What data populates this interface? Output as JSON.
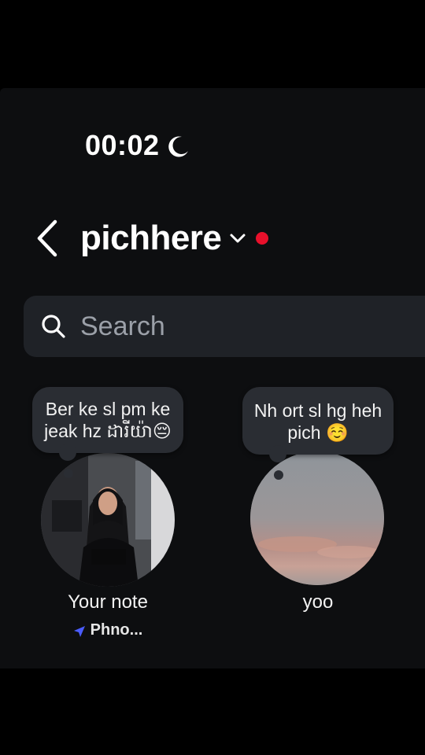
{
  "status_bar": {
    "time": "00:02",
    "moon_icon": "moon-icon"
  },
  "header": {
    "back_icon": "chevron-left-icon",
    "username": "pichhere",
    "dropdown_icon": "chevron-down-icon",
    "status_dot_color": "#e8102b"
  },
  "search": {
    "placeholder": "Search",
    "value": ""
  },
  "notes": [
    {
      "text": "Ber ke sl pm ke jeak hz ដារីយ៉ា😔",
      "label": "Your note",
      "location": "Phno...",
      "location_icon": "location-arrow-icon"
    },
    {
      "text": "Nh ort sl hg heh pich ☺️",
      "label": "yoo"
    }
  ],
  "colors": {
    "background": "#0d0e10",
    "search_bg": "#1f2227",
    "bubble_bg": "#2a2d33",
    "accent_blue": "#4a5cff"
  }
}
